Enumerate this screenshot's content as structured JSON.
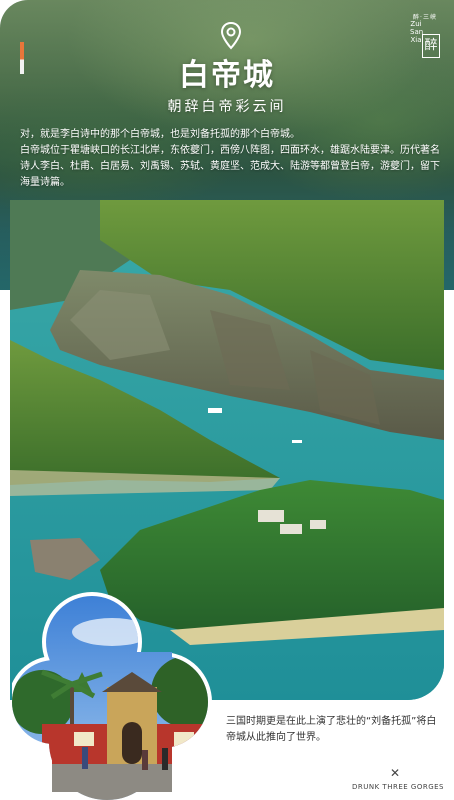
{
  "header": {
    "title": "白帝城",
    "subtitle": "朝辞白帝彩云间",
    "intro_line1": "对，就是李白诗中的那个白帝城，也是刘备托孤的那个白帝城。",
    "intro_line2": "白帝城位于瞿塘峡口的长江北岸，东依夔门，西傍八阵图，四面环水，雄踞水陆要津。历代著名诗人李白、杜甫、白居易、刘禹锡、苏轼、黄庭坚、范成大、陆游等都曾登白帝，游夔门，留下海量诗篇。"
  },
  "logo": {
    "top_text": "醉·三峡",
    "side_text": "Zui San Xia",
    "stamp": "醉"
  },
  "footer": {
    "text": "三国时期更是在此上演了悲壮的“刘备托孤”将白帝城从此推向了世界。",
    "close_glyph": "✕",
    "brand": "DRUNK THREE GORGES"
  },
  "colors": {
    "accent": "#e8763a",
    "river": "#2b9ca2",
    "text_dark": "#333333"
  },
  "icons": [
    "location-pin-icon",
    "close-icon"
  ]
}
